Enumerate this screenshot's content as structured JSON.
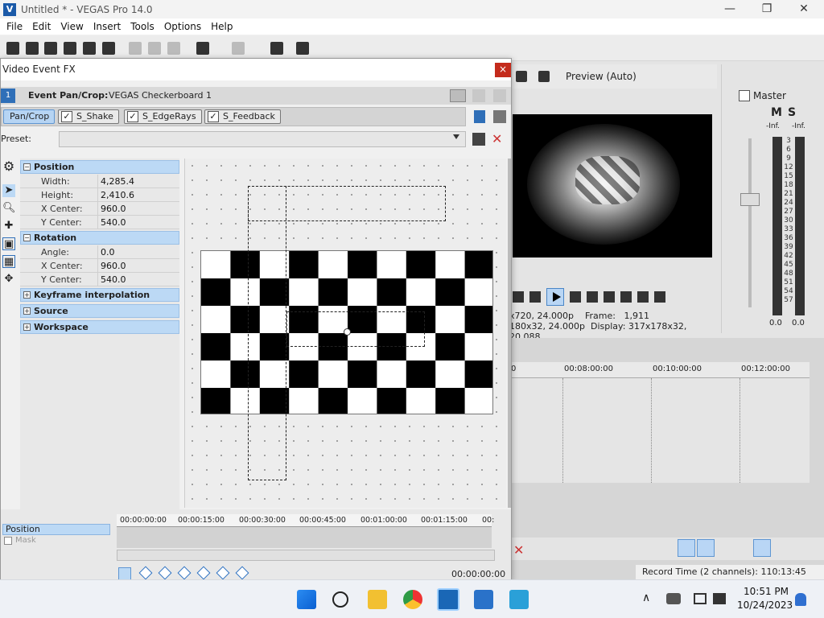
{
  "window": {
    "title": "Untitled * - VEGAS Pro 14.0",
    "logo": "V",
    "min": "—",
    "max": "❐",
    "close": "✕"
  },
  "menu": [
    "File",
    "Edit",
    "View",
    "Insert",
    "Tools",
    "Options",
    "Help"
  ],
  "preview": {
    "mode": "Preview (Auto)",
    "info_line1": "x720, 24.000p",
    "info_frame_label": "Frame:",
    "info_frame": "1,911",
    "info_line2": "180x32, 24.000p",
    "info_display_label": "Display:",
    "info_display": "317x178x32, 20.088"
  },
  "mixer": {
    "master": "Master",
    "m": "M",
    "s": "S",
    "inf_left": "-Inf.",
    "inf_right": "-Inf.",
    "scale": [
      "3",
      "6",
      "9",
      "12",
      "15",
      "18",
      "21",
      "24",
      "27",
      "30",
      "33",
      "36",
      "39",
      "42",
      "45",
      "48",
      "51",
      "54",
      "57"
    ],
    "val_left": "0.0",
    "val_right": "0.0"
  },
  "timeline": {
    "ticks": [
      "0",
      "00:08:00:00",
      "00:10:00:00",
      "00:12:00:00"
    ],
    "status": "Record Time (2 channels): 110:13:45"
  },
  "dialog": {
    "title": "Video Event FX",
    "close": "×",
    "fx_num": "1",
    "fx_label": "Event Pan/Crop:",
    "fx_value": "VEGAS Checkerboard 1",
    "chain": [
      {
        "label": "Pan/Crop"
      },
      {
        "label": "S_Shake",
        "check": "✓"
      },
      {
        "label": "S_EdgeRays",
        "check": "✓"
      },
      {
        "label": "S_Feedback",
        "check": "✓"
      }
    ],
    "preset_label": "Preset:",
    "preset_value": "",
    "sections": {
      "position": "Position",
      "rotation": "Rotation",
      "keyframe": "Keyframe interpolation",
      "source": "Source",
      "workspace": "Workspace",
      "minus": "−",
      "plus": "+"
    },
    "position_rows": [
      {
        "k": "Width:",
        "v": "4,285.4"
      },
      {
        "k": "Height:",
        "v": "2,410.6"
      },
      {
        "k": "X Center:",
        "v": "960.0"
      },
      {
        "k": "Y Center:",
        "v": "540.0"
      }
    ],
    "rotation_rows": [
      {
        "k": "Angle:",
        "v": "0.0"
      },
      {
        "k": "X Center:",
        "v": "960.0"
      },
      {
        "k": "Y Center:",
        "v": "540.0"
      }
    ],
    "keyframes": {
      "ticks": [
        "00:00:00:00",
        "00:00:15:00",
        "00:00:30:00",
        "00:00:45:00",
        "00:01:00:00",
        "00:01:15:00",
        "00:"
      ],
      "track_position": "Position",
      "track_mask": "Mask",
      "time": "00:00:00:00"
    }
  },
  "taskbar": {
    "time": "10:51 PM",
    "date": "10/24/2023"
  },
  "colors": {
    "accent": "#2f6fb8",
    "selection": "#bcd9f5",
    "close_red": "#c42b1c"
  }
}
